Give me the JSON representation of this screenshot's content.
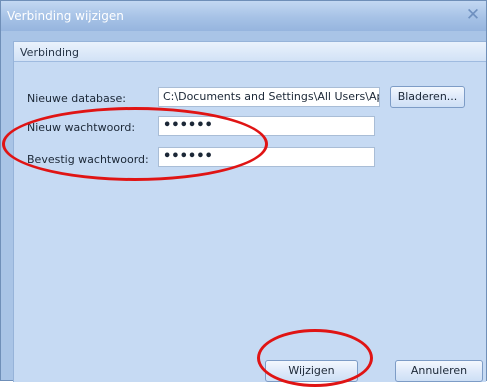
{
  "window": {
    "title": "Verbinding wijzigen",
    "close_glyph": "✕"
  },
  "group": {
    "title": "Verbinding"
  },
  "form": {
    "database_label": "Nieuwe database:",
    "database_value": "C:\\Documents and Settings\\All Users\\Ap",
    "browse_label": "Bladeren...",
    "password_label": "Nieuw wachtwoord:",
    "password_mask": "••••••",
    "confirm_label": "Bevestig wachtwoord:",
    "confirm_mask": "••••••"
  },
  "footer": {
    "apply_label": "Wijzigen",
    "cancel_label": "Annuleren"
  },
  "colors": {
    "annotation": "#e01414",
    "window_bg": "#a9c4e6",
    "group_bg": "#c6daf3"
  }
}
